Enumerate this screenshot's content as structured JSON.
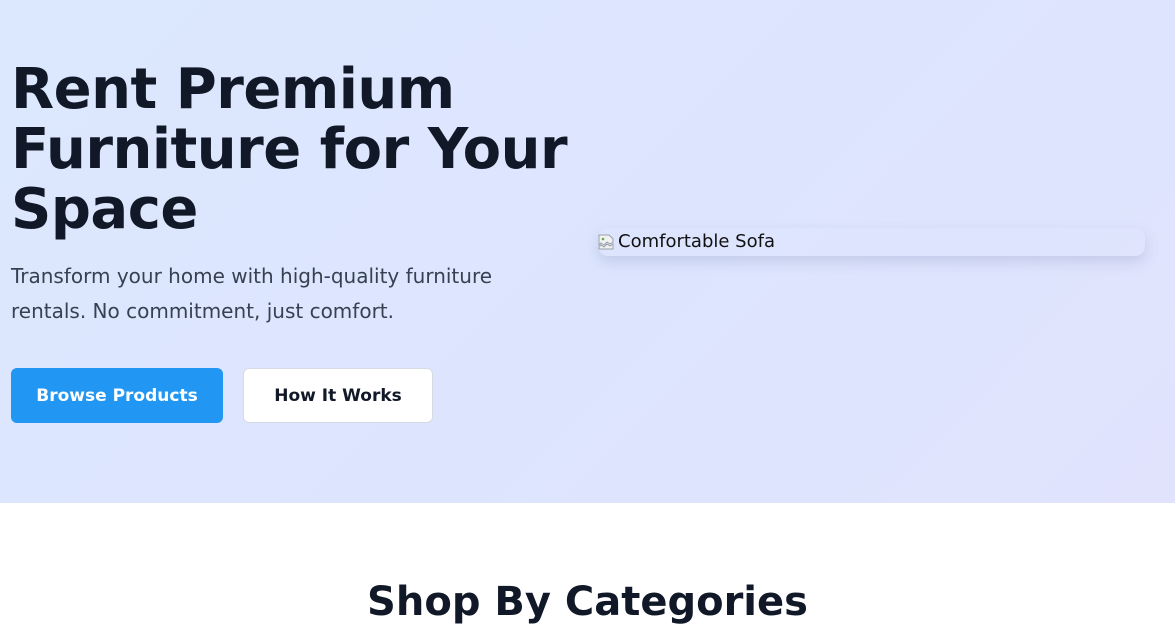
{
  "hero": {
    "title": "Rent Premium Furniture for Your Space",
    "subtitle": "Transform your home with high-quality furniture rentals. No commitment, just comfort.",
    "primary_button": "Browse Products",
    "secondary_button": "How It Works",
    "image_alt": "Comfortable Sofa",
    "image_icon": "broken-image-icon"
  },
  "categories": {
    "title": "Shop By Categories"
  },
  "colors": {
    "primary": "#2196f3",
    "heading": "#111827",
    "body_text": "#374151",
    "hero_bg": "#dde6fe"
  }
}
